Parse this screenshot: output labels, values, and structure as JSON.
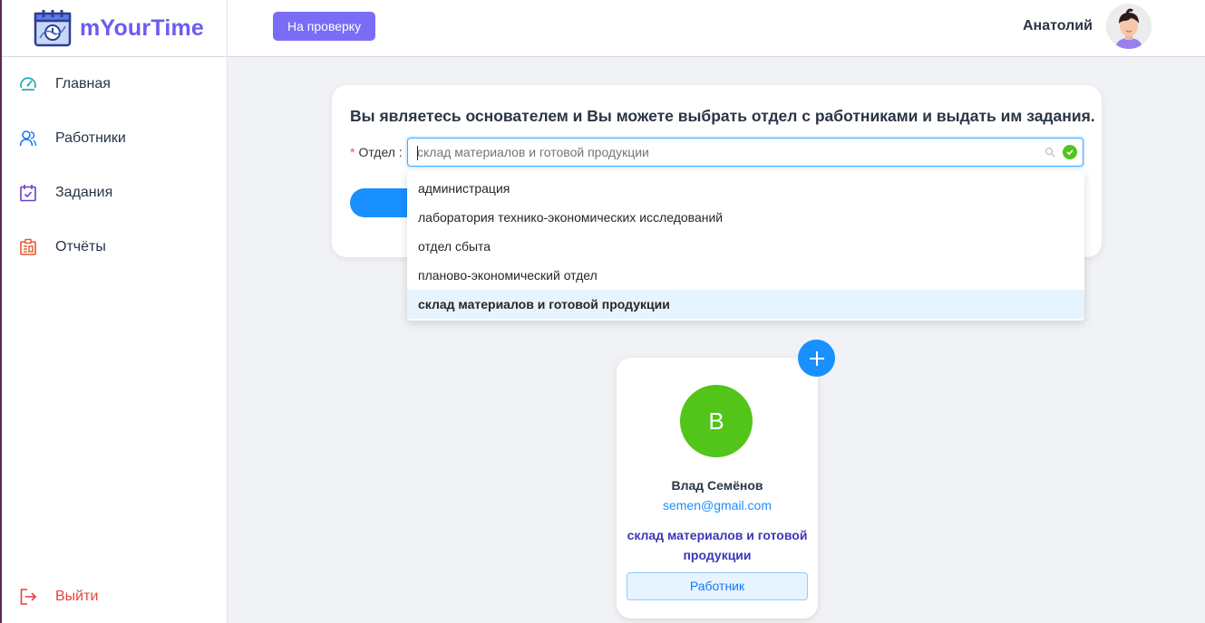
{
  "app": {
    "name": "mYourTime"
  },
  "header": {
    "review_label": "На проверку",
    "user_name": "Анатолий"
  },
  "sidebar": {
    "items": [
      {
        "label": "Главная",
        "icon": "dashboard-icon"
      },
      {
        "label": "Работники",
        "icon": "users-icon"
      },
      {
        "label": "Задания",
        "icon": "calendar-check-icon"
      },
      {
        "label": "Отчёты",
        "icon": "reports-icon"
      }
    ],
    "logout_label": "Выйти"
  },
  "form": {
    "title": "Вы являетесь основателем и Вы можете выбрать отдел с работниками и выдать им задания.",
    "required_mark": "*",
    "department_label": "Отдел :",
    "department_value": "склад материалов и готовой продукции"
  },
  "dropdown": {
    "options": [
      "администрация",
      "лаборатория технико-экономических исследований",
      "отдел сбыта",
      "планово-экономический отдел",
      "склад материалов и готовой продукции"
    ],
    "selected_index": 4
  },
  "worker": {
    "initial": "В",
    "name": "Влад Семёнов",
    "email": "semen@gmail.com",
    "department": "склад материалов и готовой продукции",
    "role": "Работник"
  },
  "colors": {
    "brand": "#6a5cf0",
    "primary": "#1890ff",
    "success": "#52c41a",
    "danger": "#e8413d"
  }
}
